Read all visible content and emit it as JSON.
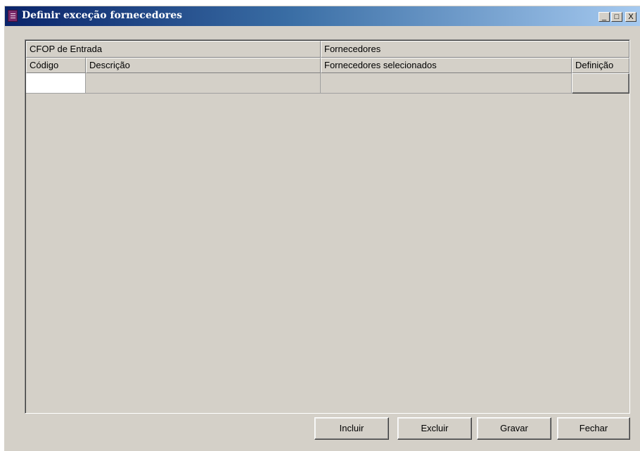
{
  "window": {
    "title": "Definir exceção fornecedores",
    "controls": {
      "minimize": "_",
      "maximize": "□",
      "close": "X"
    }
  },
  "grid": {
    "group_headers": [
      "CFOP de Entrada",
      "Fornecedores"
    ],
    "columns": [
      "Código",
      "Descrição",
      "Fornecedores selecionados",
      "Definição"
    ],
    "rows": [
      {
        "codigo": "",
        "descricao": "",
        "fornecedores_selecionados": "",
        "definicao": ""
      }
    ]
  },
  "buttons": {
    "incluir": "Incluir",
    "excluir": "Excluir",
    "gravar": "Gravar",
    "fechar": "Fechar"
  },
  "colors": {
    "titlebar_start": "#0a246a",
    "titlebar_end": "#a6caf0",
    "window_face": "#d4d0c8"
  }
}
